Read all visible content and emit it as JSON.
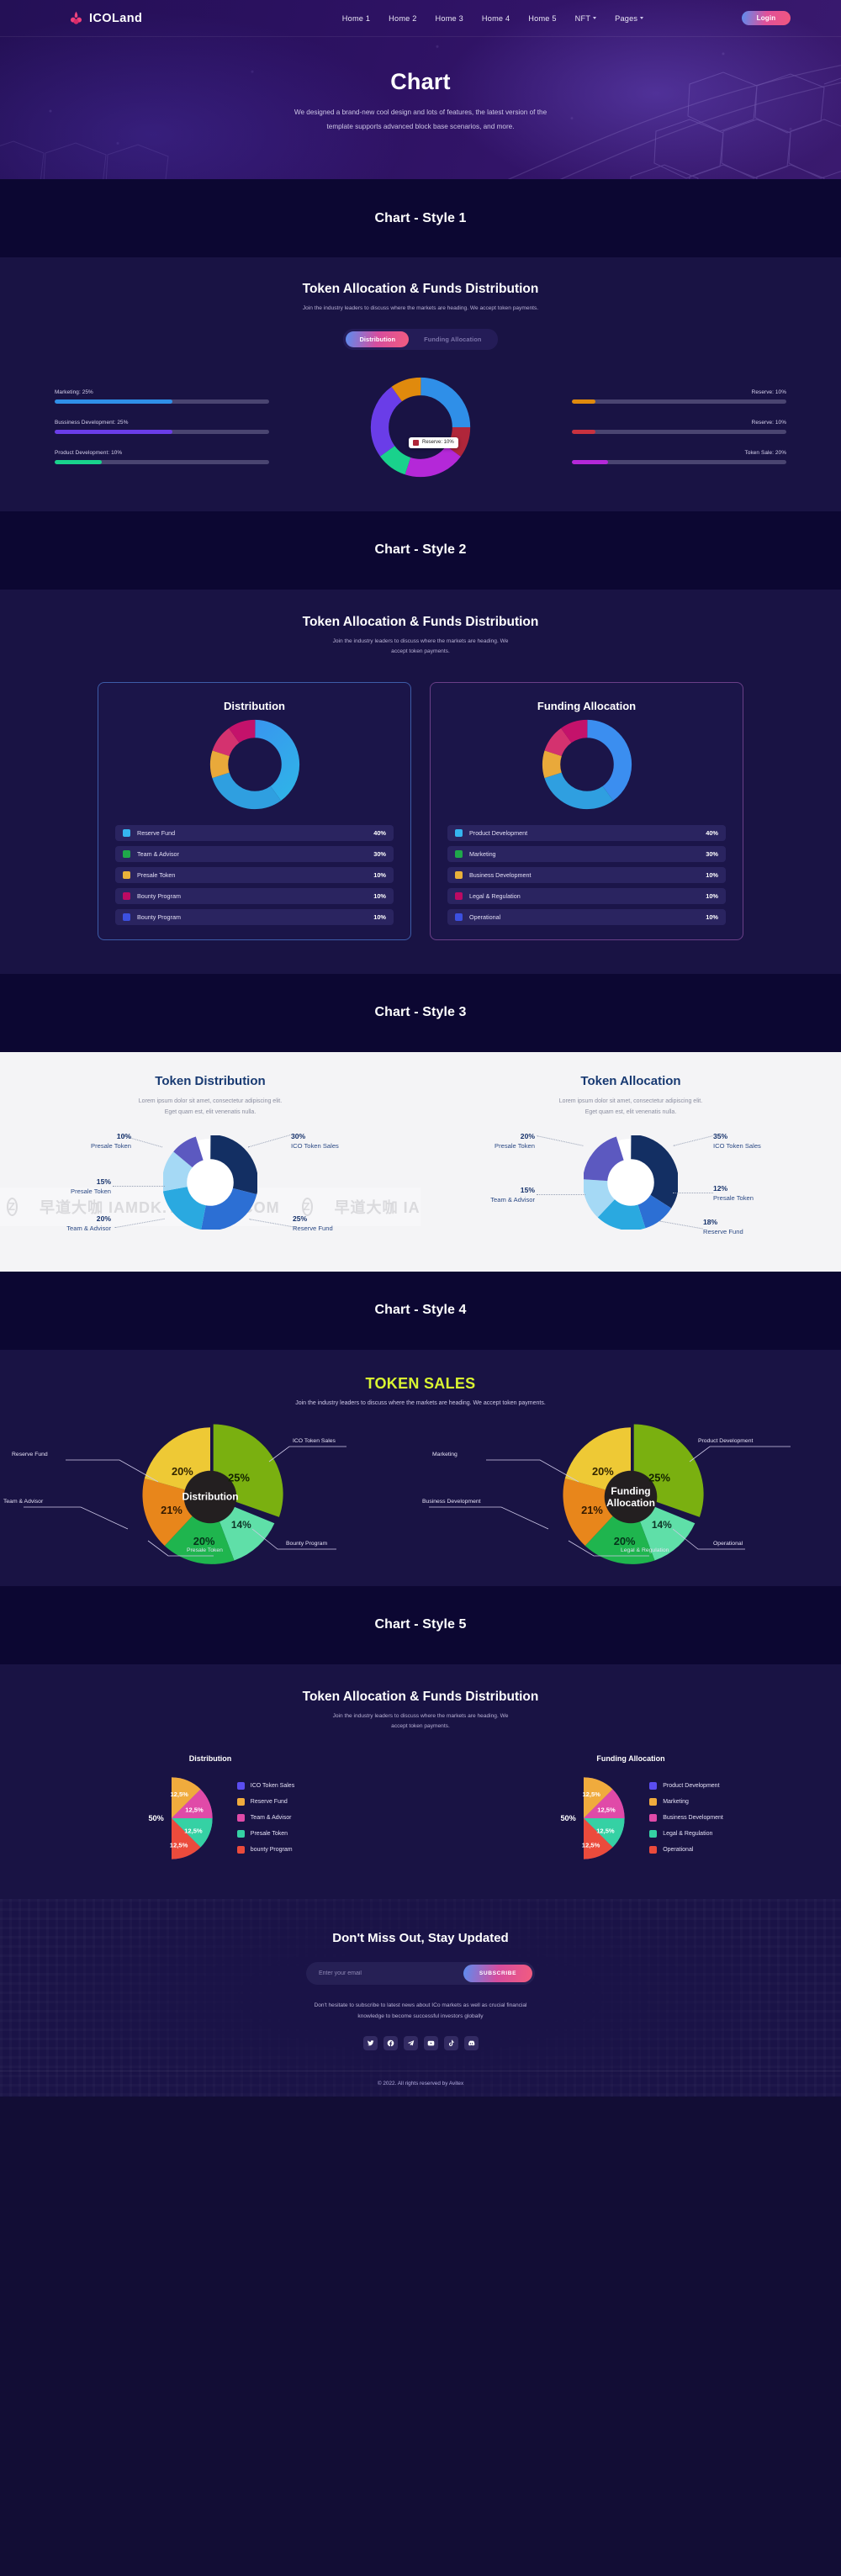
{
  "header": {
    "brand": "ICOLand",
    "nav": [
      {
        "label": "Home 1",
        "caret": false
      },
      {
        "label": "Home 2",
        "caret": false
      },
      {
        "label": "Home 3",
        "caret": false
      },
      {
        "label": "Home 4",
        "caret": false
      },
      {
        "label": "Home 5",
        "caret": false
      },
      {
        "label": "NFT",
        "caret": true
      },
      {
        "label": "Pages",
        "caret": true
      }
    ],
    "login_label": "Login"
  },
  "hero": {
    "title": "Chart",
    "line1": "We designed a brand-new cool design and lots of features, the latest version of the",
    "line2": "template supports advanced block base scenarios, and more."
  },
  "banners": {
    "s1": "Chart - Style 1",
    "s2": "Chart - Style 2",
    "s3": "Chart - Style 3",
    "s4": "Chart - Style 4",
    "s5": "Chart - Style 5"
  },
  "style1": {
    "heading": "Token Allocation & Funds Distribution",
    "subheading": "Join the industry leaders to discuss where the markets are heading. We accept token payments.",
    "tabs": [
      {
        "label": "Distribution",
        "active": true
      },
      {
        "label": "Funding Allocation",
        "active": false
      }
    ],
    "tooltip": {
      "label": "Reserve: 10%",
      "color": "#b0263a"
    },
    "bars_left": [
      {
        "label": "Marketing: 25%",
        "pct": 55,
        "color": "#2f8fe8"
      },
      {
        "label": "Bussiness Development: 25%",
        "pct": 55,
        "color": "#6a3de8"
      },
      {
        "label": "Product Development: 10%",
        "pct": 22,
        "color": "#19d28c"
      }
    ],
    "bars_right": [
      {
        "label": "Reserve: 10%",
        "pct": 11,
        "color": "#e08a0d"
      },
      {
        "label": "Reserve: 10%",
        "pct": 11,
        "color": "#c9323f"
      },
      {
        "label": "Token Sale: 20%",
        "pct": 17,
        "color": "#b428d8"
      }
    ],
    "chart_data": {
      "type": "pie",
      "title": "Token Allocation & Funds Distribution",
      "labels": [
        "Marketing",
        "Bussiness Development",
        "Product Development",
        "Reserve",
        "Reserve",
        "Token Sale"
      ],
      "values": [
        25,
        25,
        10,
        10,
        10,
        20
      ],
      "colors": [
        "#2f8fe8",
        "#6a3de8",
        "#19d28c",
        "#e08a0d",
        "#b0263a",
        "#b428d8"
      ]
    }
  },
  "style2": {
    "heading": "Token Allocation & Funds Distribution",
    "sub1": "Join the industry leaders to discuss where the markets are heading. We",
    "sub2": "accept token payments.",
    "cards": [
      {
        "title": "Distribution",
        "items": [
          {
            "name": "Reserve Fund",
            "value": "40%",
            "color": "#35b5ef"
          },
          {
            "name": "Team & Advisor",
            "value": "30%",
            "color": "#1fa84a"
          },
          {
            "name": "Presale Token",
            "value": "10%",
            "color": "#e9b13a"
          },
          {
            "name": "Bounty Program",
            "value": "10%",
            "color": "#bd0a63"
          },
          {
            "name": "Bounty Program",
            "value": "10%",
            "color": "#3c50e0"
          }
        ]
      },
      {
        "title": "Funding Allocation",
        "items": [
          {
            "name": "Product Development",
            "value": "40%",
            "color": "#35b5ef"
          },
          {
            "name": "Marketing",
            "value": "30%",
            "color": "#1fa84a"
          },
          {
            "name": "Business Development",
            "value": "10%",
            "color": "#e9b13a"
          },
          {
            "name": "Legal & Regulation",
            "value": "10%",
            "color": "#bd0a63"
          },
          {
            "name": "Operational",
            "value": "10%",
            "color": "#3c50e0"
          }
        ]
      }
    ],
    "chart_data": [
      {
        "type": "pie",
        "title": "Distribution",
        "labels": [
          "Reserve Fund",
          "Team & Advisor",
          "Presale Token",
          "Bounty Program",
          "Bounty Program"
        ],
        "values": [
          40,
          30,
          10,
          10,
          10
        ],
        "colors": [
          "#35b5ef",
          "#1fa84a",
          "#e9b13a",
          "#bd0a63",
          "#3c50e0"
        ]
      },
      {
        "type": "pie",
        "title": "Funding Allocation",
        "labels": [
          "Product Development",
          "Marketing",
          "Business Development",
          "Legal & Regulation",
          "Operational"
        ],
        "values": [
          40,
          30,
          10,
          10,
          10
        ],
        "colors": [
          "#35b5ef",
          "#1fa84a",
          "#e9b13a",
          "#bd0a63",
          "#3c50e0"
        ]
      }
    ]
  },
  "style3": {
    "watermark": "早道大咖  IAMDK.TAOBAO.COM",
    "left": {
      "title": "Token Distribution",
      "sub1": "Lorem ipsum dolor sit amet, consectetur adipiscing elit.",
      "sub2": "Eget quam est, elit venenatis nulla.",
      "labels": [
        {
          "pct": "10%",
          "name": "Presale Token"
        },
        {
          "pct": "30%",
          "name": "ICO Token Sales"
        },
        {
          "pct": "15%",
          "name": "Presale Token"
        },
        {
          "pct": "20%",
          "name": "Team & Advisor"
        },
        {
          "pct": "25%",
          "name": "Reserve Fund"
        }
      ],
      "chart_data": {
        "type": "pie",
        "title": "Token Distribution",
        "labels": [
          "ICO Token Sales",
          "Reserve Fund",
          "Team & Advisor",
          "Presale Token",
          "Presale Token"
        ],
        "values": [
          30,
          25,
          20,
          15,
          10
        ],
        "colors": [
          "#132f63",
          "#2c6fd4",
          "#2aa9e0",
          "#a5d9f5",
          "#5c59c0"
        ]
      }
    },
    "right": {
      "title": "Token Allocation",
      "sub1": "Lorem ipsum dolor sit amet, consectetur adipiscing elit.",
      "sub2": "Eget quam est, elit venenatis nulla.",
      "labels": [
        {
          "pct": "20%",
          "name": "Presale Token"
        },
        {
          "pct": "35%",
          "name": "ICO Token Sales"
        },
        {
          "pct": "15%",
          "name": "Team & Advisor"
        },
        {
          "pct": "12%",
          "name": "Presale Token"
        },
        {
          "pct": "18%",
          "name": "Reserve Fund"
        }
      ],
      "chart_data": {
        "type": "pie",
        "title": "Token Allocation",
        "labels": [
          "ICO Token Sales",
          "Presale Token",
          "Reserve Fund",
          "Team & Advisor",
          "Presale Token"
        ],
        "values": [
          35,
          12,
          18,
          15,
          20
        ],
        "colors": [
          "#132f63",
          "#2c6fd4",
          "#2aa9e0",
          "#a5d9f5",
          "#5c59c0"
        ]
      }
    }
  },
  "style4": {
    "title": "TOKEN SALES",
    "subtitle": "Join the industry leaders to discuss where the markets are heading. We accept token payments.",
    "left": {
      "center": "Distribution",
      "slices": [
        {
          "pct": "25%",
          "name": "ICO Token Sales",
          "color": "#7ab010"
        },
        {
          "pct": "14%",
          "name": "Bounty Program",
          "color": "#5fdfa8"
        },
        {
          "pct": "20%",
          "name": "Presale Token",
          "color": "#1fb54e"
        },
        {
          "pct": "21%",
          "name": "Team & Advisor",
          "color": "#e8861b"
        },
        {
          "pct": "20%",
          "name": "Reserve Fund",
          "color": "#eec935"
        }
      ],
      "chart_data": {
        "type": "pie",
        "title": "Distribution",
        "labels": [
          "ICO Token Sales",
          "Bounty Program",
          "Presale Token",
          "Team & Advisor",
          "Reserve Fund"
        ],
        "values": [
          25,
          14,
          20,
          21,
          20
        ],
        "colors": [
          "#7ab010",
          "#5fdfa8",
          "#1fb54e",
          "#e8861b",
          "#eec935"
        ]
      }
    },
    "right": {
      "center1": "Funding",
      "center2": "Allocation",
      "slices": [
        {
          "pct": "25%",
          "name": "Product Development",
          "color": "#7ab010"
        },
        {
          "pct": "14%",
          "name": "Operational",
          "color": "#5fdfa8"
        },
        {
          "pct": "20%",
          "name": "Legal & Regulation",
          "color": "#1fb54e"
        },
        {
          "pct": "21%",
          "name": "Business Development",
          "color": "#e8861b"
        },
        {
          "pct": "20%",
          "name": "Marketing",
          "color": "#eec935"
        }
      ],
      "chart_data": {
        "type": "pie",
        "title": "Funding Allocation",
        "labels": [
          "Product Development",
          "Operational",
          "Legal & Regulation",
          "Business Development",
          "Marketing"
        ],
        "values": [
          25,
          14,
          20,
          21,
          20
        ],
        "colors": [
          "#7ab010",
          "#5fdfa8",
          "#1fb54e",
          "#e8861b",
          "#eec935"
        ]
      }
    }
  },
  "style5": {
    "heading": "Token Allocation & Funds Distribution",
    "sub1": "Join the industry leaders to discuss where the markets are heading. We",
    "sub2": "accept token payments.",
    "left": {
      "title": "Distribution",
      "legend": [
        {
          "name": "ICO Token Sales",
          "color": "#5b4df0"
        },
        {
          "name": "Reserve Fund",
          "color": "#f0ab3d"
        },
        {
          "name": "Team & Advisor",
          "color": "#e04aa8"
        },
        {
          "name": "Presale Token",
          "color": "#35d1a4"
        },
        {
          "name": "bounty Program",
          "color": "#eb4b3c"
        }
      ],
      "chart_data": {
        "type": "pie",
        "title": "Distribution",
        "labels": [
          "ICO Token Sales",
          "Reserve Fund",
          "Team & Advisor",
          "Presale Token",
          "bounty Program"
        ],
        "values": [
          50,
          12.5,
          12.5,
          12.5,
          12.5
        ],
        "value_labels": [
          "50%",
          "12,5%",
          "12,5%",
          "12,5%",
          "12,5%"
        ],
        "colors": [
          "#5b4df0",
          "#f0ab3d",
          "#e04aa8",
          "#35d1a4",
          "#eb4b3c"
        ]
      }
    },
    "right": {
      "title": "Funding Allocation",
      "legend": [
        {
          "name": "Product Development",
          "color": "#5b4df0"
        },
        {
          "name": "Marketing",
          "color": "#f0ab3d"
        },
        {
          "name": "Business Development",
          "color": "#e04aa8"
        },
        {
          "name": "Legal & Regulation",
          "color": "#35d1a4"
        },
        {
          "name": "Operational",
          "color": "#eb4b3c"
        }
      ],
      "chart_data": {
        "type": "pie",
        "title": "Funding Allocation",
        "labels": [
          "Product Development",
          "Marketing",
          "Business Development",
          "Legal & Regulation",
          "Operational"
        ],
        "values": [
          50,
          12.5,
          12.5,
          12.5,
          12.5
        ],
        "value_labels": [
          "50%",
          "12,5%",
          "12,5%",
          "12,5%",
          "12,5%"
        ],
        "colors": [
          "#5b4df0",
          "#f0ab3d",
          "#e04aa8",
          "#35d1a4",
          "#eb4b3c"
        ]
      }
    }
  },
  "footer": {
    "heading": "Don't Miss Out, Stay Updated",
    "input_placeholder": "Enter your email",
    "subscribe_label": "SUBSCRIBE",
    "note1": "Don't hesitate to subscribe to latest news about ICo markets as well as crucial financial",
    "note2": "knowledge to become successful investors globally",
    "socials": [
      "twitter-icon",
      "facebook-icon",
      "telegram-icon",
      "youtube-icon",
      "tiktok-icon",
      "discord-icon"
    ],
    "copyright": "© 2022. All rights reserved by Avitex"
  }
}
